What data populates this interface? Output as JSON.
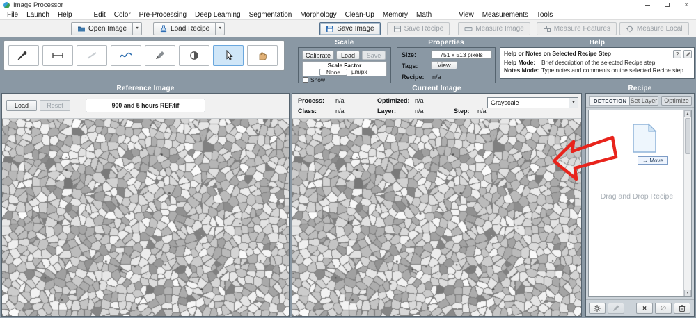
{
  "window": {
    "title": "Image Processor"
  },
  "glyphs": {
    "close": "×",
    "dropdown_down": "▼",
    "arrow_up": "▲",
    "arrow_down": "▼",
    "null_sign": "∅",
    "clear": "×",
    "question": "?"
  },
  "menubar": {
    "groups": [
      {
        "items": [
          "File",
          "Launch",
          "Help"
        ]
      },
      {
        "items": [
          "Edit",
          "Color",
          "Pre-Processing",
          "Deep Learning",
          "Segmentation",
          "Morphology",
          "Clean-Up",
          "Memory",
          "Math"
        ]
      },
      {
        "items": [
          "View",
          "Measurements",
          "Tools"
        ]
      }
    ]
  },
  "toolbar": {
    "open_image": "Open Image",
    "load_recipe": "Load Recipe",
    "save_image": "Save Image",
    "save_recipe": "Save Recipe",
    "measure_image": "Measure Image",
    "measure_features": "Measure Features",
    "measure_local": "Measure Local"
  },
  "tools": [
    "eyedropper",
    "measure-line",
    "line",
    "intensity-profile",
    "pencil",
    "contrast",
    "pointer-select",
    "pan-hand"
  ],
  "tools_selected": "pointer-select",
  "scale_panel": {
    "header": "Scale",
    "calibrate_button": "Calibrate",
    "load_button": "Load",
    "save_button": "Save",
    "scale_factor_label": "Scale Factor",
    "scale_value": "None",
    "scale_unit": "µm/px",
    "show_label": "Show",
    "show_checked": false
  },
  "properties_panel": {
    "header": "Properties",
    "size_label": "Size:",
    "size_value": "751 x 513 pixels",
    "tags_label": "Tags:",
    "tags_button": "View",
    "recipe_label": "Recipe:",
    "recipe_value": "n/a"
  },
  "help_panel": {
    "header": "Help",
    "title": "Help or Notes on Selected Recipe Step",
    "help_mode_label": "Help Mode:",
    "help_mode_text": "Brief description of the selected Recipe step",
    "notes_mode_label": "Notes Mode:",
    "notes_mode_text": "Type notes and comments on the selected Recipe step"
  },
  "reference_panel": {
    "header": "Reference Image",
    "load_button": "Load",
    "reset_button": "Reset",
    "filename": "900 and 5 hours REF.tif"
  },
  "current_panel": {
    "header": "Current Image",
    "process_label": "Process:",
    "process_value": "n/a",
    "optimized_label": "Optimized:",
    "optimized_value": "n/a",
    "class_label": "Class:",
    "class_value": "n/a",
    "layer_label": "Layer:",
    "layer_value": "n/a",
    "step_label": "Step:",
    "step_value": "n/a",
    "display_mode": "Grayscale"
  },
  "recipe_panel": {
    "header": "Recipe",
    "tab": "DETECTION",
    "set_layer_button": "Set Layer",
    "optimize_button": "Optimize",
    "move_label": "→ Move",
    "drop_hint": "Drag and Drop Recipe"
  },
  "colors": {
    "workspace_background": "#8a98a4",
    "selected_tool_background": "#cfe6f8",
    "annotation_arrow": "#e8241c",
    "accent_blue": "#2e6db4"
  },
  "icons": [
    "app-logo-icon",
    "minimize-icon",
    "maximize-icon",
    "close-icon",
    "folder-open-icon",
    "dropdown-arrow-icon",
    "recipe-flask-icon",
    "save-disk-icon",
    "measure-ruler-icon",
    "measure-features-icon",
    "measure-local-icon",
    "eyedropper-icon",
    "measure-line-icon",
    "line-icon",
    "profile-wave-icon",
    "pencil-icon",
    "contrast-icon",
    "pointer-cursor-icon",
    "pan-hand-icon",
    "document-page-icon",
    "gear-icon",
    "edit-pencil-icon",
    "clear-x-icon",
    "null-icon",
    "trash-icon",
    "scroll-up-icon",
    "scroll-down-icon",
    "help-question-icon",
    "notes-pencil-icon",
    "red-arrow-annotation"
  ]
}
